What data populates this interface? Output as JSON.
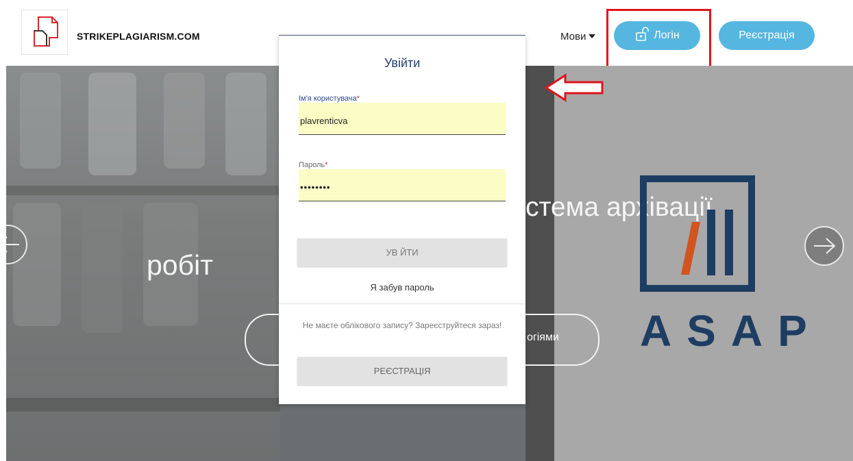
{
  "header": {
    "brand": "STRIKEPLAGIARISM.COM",
    "languages_label": "Мови",
    "login_button": "Логін",
    "register_button": "Реєстрація"
  },
  "hero": {
    "headline_part_right": "стема архівації",
    "headline_part_left": "робіт",
    "cta_partial_text": "огіями",
    "logo_text": "ASAP"
  },
  "login_modal": {
    "title": "Увійти",
    "username_label": "Ім'я користувача",
    "username_value": "plavrenticva",
    "password_label": "Пароль",
    "password_value": "••••••••",
    "required_mark": "*",
    "submit_button": "УВ ЙТИ",
    "forgot_password": "Я забув пароль",
    "no_account_text": "Не маєте облікового запису? Зареєструйтеся зараз!",
    "register_button": "РЕЄСТРАЦІЯ"
  },
  "colors": {
    "accent": "#55b6df",
    "highlight": "#e1131b",
    "asap_navy": "#1e3d63",
    "asap_orange": "#d2541e",
    "field_fill": "#fbfdc4"
  },
  "icons": [
    "document-logo-icon",
    "lock-open-icon",
    "chevron-left-icon",
    "chevron-right-icon",
    "pointer-arrow-icon"
  ]
}
